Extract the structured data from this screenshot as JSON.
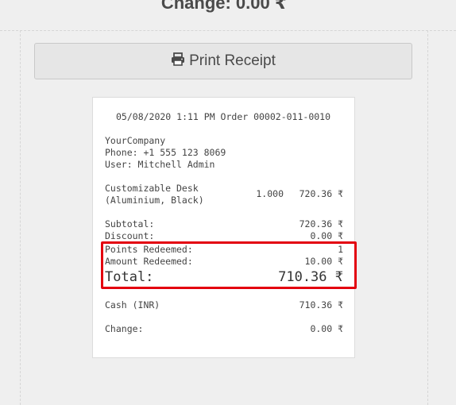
{
  "header": {
    "change_text": "Change: 0.00 ₹"
  },
  "print_button": {
    "label": "Print Receipt",
    "icon": "printer-icon"
  },
  "receipt": {
    "order_line": "05/08/2020 1:11 PM Order 00002-011-0010",
    "company": "YourCompany",
    "phone": "Phone: +1 555 123 8069",
    "user": "User: Mitchell Admin",
    "items": [
      {
        "name_line1": "Customizable Desk",
        "name_line2": "(Aluminium, Black)",
        "qty": "1.000",
        "price": "720.36 ₹"
      }
    ],
    "subtotal_label": "Subtotal:",
    "subtotal_value": "720.36 ₹",
    "discount_label": "Discount:",
    "discount_value": "0.00 ₹",
    "points_label": "Points Redeemed:",
    "points_value": "1",
    "amount_label": "Amount Redeemed:",
    "amount_value": "10.00 ₹",
    "total_label": "Total:",
    "total_value": "710.36 ₹",
    "payment_label": "Cash (INR)",
    "payment_value": "710.36 ₹",
    "change_label": "Change:",
    "change_value": "0.00 ₹"
  },
  "colors": {
    "highlight": "#e3000f",
    "background": "#efefef"
  }
}
